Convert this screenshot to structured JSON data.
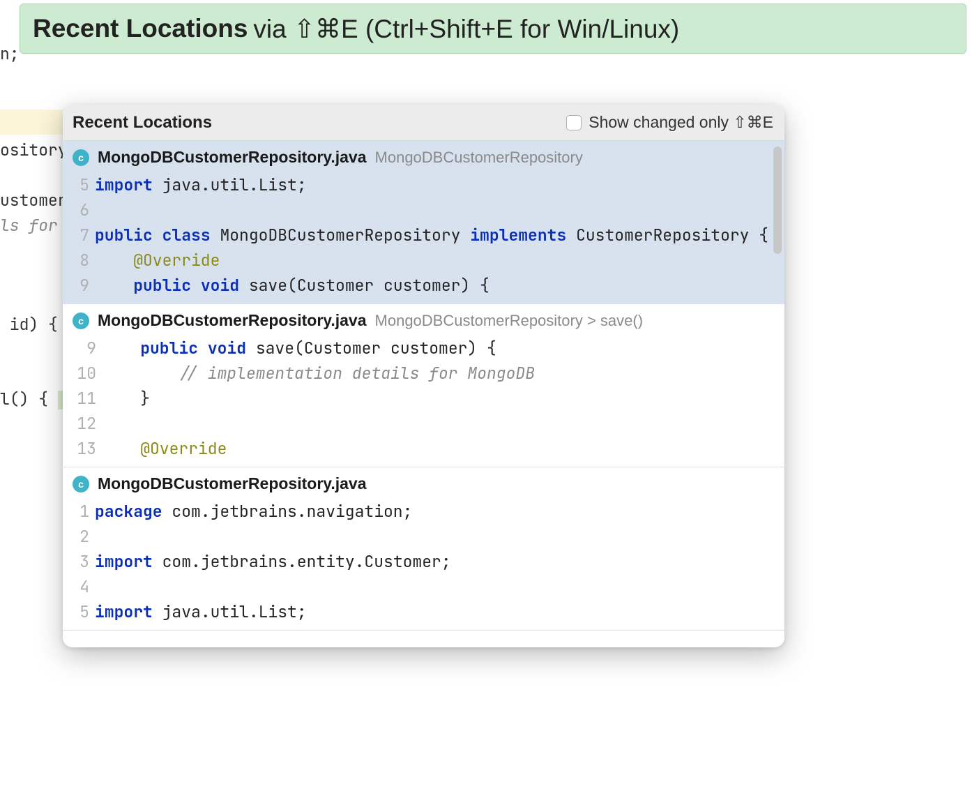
{
  "banner": {
    "title_bold": "Recent Locations",
    "title_rest": " via ⇧⌘E (Ctrl+Shift+E for Win/Linux)"
  },
  "background_fragments": {
    "f0": "n;",
    "f1": "ository",
    "f2": "ustomer",
    "f3": "ls for",
    "f4": " id) {",
    "f5": "l() { "
  },
  "popup": {
    "title": "Recent Locations",
    "show_changed_label": "Show changed only ⇧⌘E"
  },
  "locations": [
    {
      "icon_letter": "c",
      "file": "MongoDBCustomerRepository.java",
      "breadcrumb": "MongoDBCustomerRepository",
      "lines": [
        {
          "n": "5",
          "segments": [
            [
              "kw",
              "import"
            ],
            [
              "",
              " java.util.List;"
            ]
          ]
        },
        {
          "n": "6",
          "segments": [
            [
              "",
              ""
            ]
          ]
        },
        {
          "n": "7",
          "segments": [
            [
              "kw",
              "public"
            ],
            [
              "",
              " "
            ],
            [
              "kw",
              "class"
            ],
            [
              "",
              " MongoDBCustomerRepository "
            ],
            [
              "kw",
              "implements"
            ],
            [
              "",
              " CustomerRepository {"
            ]
          ]
        },
        {
          "n": "8",
          "segments": [
            [
              "",
              "    "
            ],
            [
              "ann",
              "@Override"
            ]
          ]
        },
        {
          "n": "9",
          "segments": [
            [
              "",
              "    "
            ],
            [
              "kw",
              "public"
            ],
            [
              "",
              " "
            ],
            [
              "kw",
              "void"
            ],
            [
              "",
              " save(Customer customer) {"
            ]
          ]
        }
      ]
    },
    {
      "icon_letter": "c",
      "file": "MongoDBCustomerRepository.java",
      "breadcrumb": "MongoDBCustomerRepository > save()",
      "lines": [
        {
          "n": "9",
          "segments": [
            [
              "",
              "    "
            ],
            [
              "kw",
              "public"
            ],
            [
              "",
              " "
            ],
            [
              "kw",
              "void"
            ],
            [
              "",
              " save(Customer customer) {"
            ]
          ]
        },
        {
          "n": "10",
          "segments": [
            [
              "",
              "        "
            ],
            [
              "cmt",
              "// implementation details for MongoDB"
            ]
          ]
        },
        {
          "n": "11",
          "segments": [
            [
              "",
              "    }"
            ]
          ]
        },
        {
          "n": "12",
          "segments": [
            [
              "",
              ""
            ]
          ]
        },
        {
          "n": "13",
          "segments": [
            [
              "",
              "    "
            ],
            [
              "ann",
              "@Override"
            ]
          ]
        }
      ]
    },
    {
      "icon_letter": "c",
      "file": "MongoDBCustomerRepository.java",
      "breadcrumb": "",
      "lines": [
        {
          "n": "1",
          "segments": [
            [
              "kw",
              "package"
            ],
            [
              "",
              " com.jetbrains.navigation;"
            ]
          ]
        },
        {
          "n": "2",
          "segments": [
            [
              "",
              ""
            ]
          ]
        },
        {
          "n": "3",
          "segments": [
            [
              "kw",
              "import"
            ],
            [
              "",
              " com.jetbrains.entity.Customer;"
            ]
          ]
        },
        {
          "n": "4",
          "segments": [
            [
              "",
              ""
            ]
          ]
        },
        {
          "n": "5",
          "segments": [
            [
              "kw",
              "import"
            ],
            [
              "",
              " java.util.List;"
            ]
          ]
        }
      ]
    }
  ]
}
